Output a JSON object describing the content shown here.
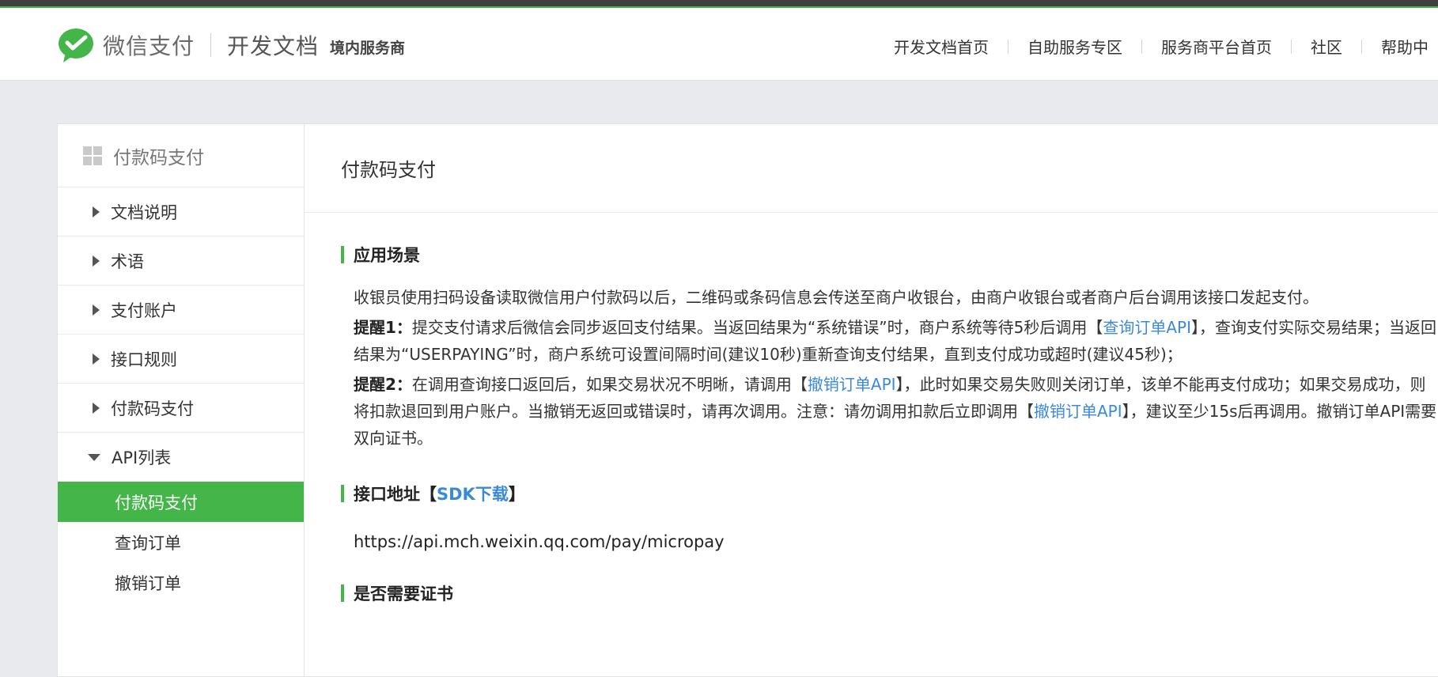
{
  "header": {
    "brand": "微信支付",
    "doc_title": "开发文档",
    "doc_subtitle": "境内服务商",
    "nav": [
      "开发文档首页",
      "自助服务专区",
      "服务商平台首页",
      "社区",
      "帮助中"
    ]
  },
  "sidebar": {
    "title": "付款码支付",
    "items": [
      "文档说明",
      "术语",
      "支付账户",
      "接口规则",
      "付款码支付"
    ],
    "expanded": "API列表",
    "sub_items": [
      "付款码支付",
      "查询订单",
      "撤销订单"
    ],
    "active_sub_item": "付款码支付"
  },
  "main": {
    "title": "付款码支付",
    "section1": {
      "heading": "应用场景",
      "desc": "收银员使用扫码设备读取微信用户付款码以后，二维码或条码信息会传送至商户收银台，由商户收银台或者商户后台调用该接口发起支付。",
      "tip1": {
        "label": "提醒1：",
        "text_a": "提交支付请求后微信会同步返回支付结果。当返回结果为“系统错误”时，商户系统等待5秒后调用【",
        "link": "查询订单API",
        "text_b": "】，查询支付实际交易结果；当返回结果为“USERPAYING”时，商户系统可设置间隔时间(建议10秒)重新查询支付结果，直到支付成功或超时(建议45秒)；"
      },
      "tip2": {
        "label": "提醒2：",
        "text_a": "在调用查询接口返回后，如果交易状况不明晰，请调用【",
        "link1": "撤销订单API",
        "text_b": "】，此时如果交易失败则关闭订单，该单不能再支付成功；如果交易成功，则将扣款退回到用户账户。当撤销无返回或错误时，请再次调用。注意：请勿调用扣款后立即调用【",
        "link2": "撤销订单API",
        "text_c": "】，建议至少15s后再调用。撤销订单API需要双向证书。"
      }
    },
    "section2": {
      "heading": "接口地址【",
      "link": "SDK下载",
      "heading_end": "】",
      "url": "https://api.mch.weixin.qq.com/pay/micropay"
    },
    "section3": {
      "heading": "是否需要证书"
    }
  },
  "colors": {
    "brand_green": "#44b549",
    "link_blue": "#3a8ad9",
    "top_bar": "#3f3f3f",
    "page_bg": "#e9eaed"
  },
  "icons": {
    "logo": "wechat-pay-logo-icon",
    "sidebar": "grid-icon",
    "collapsed": "triangle-right-icon",
    "expanded": "triangle-down-icon"
  }
}
